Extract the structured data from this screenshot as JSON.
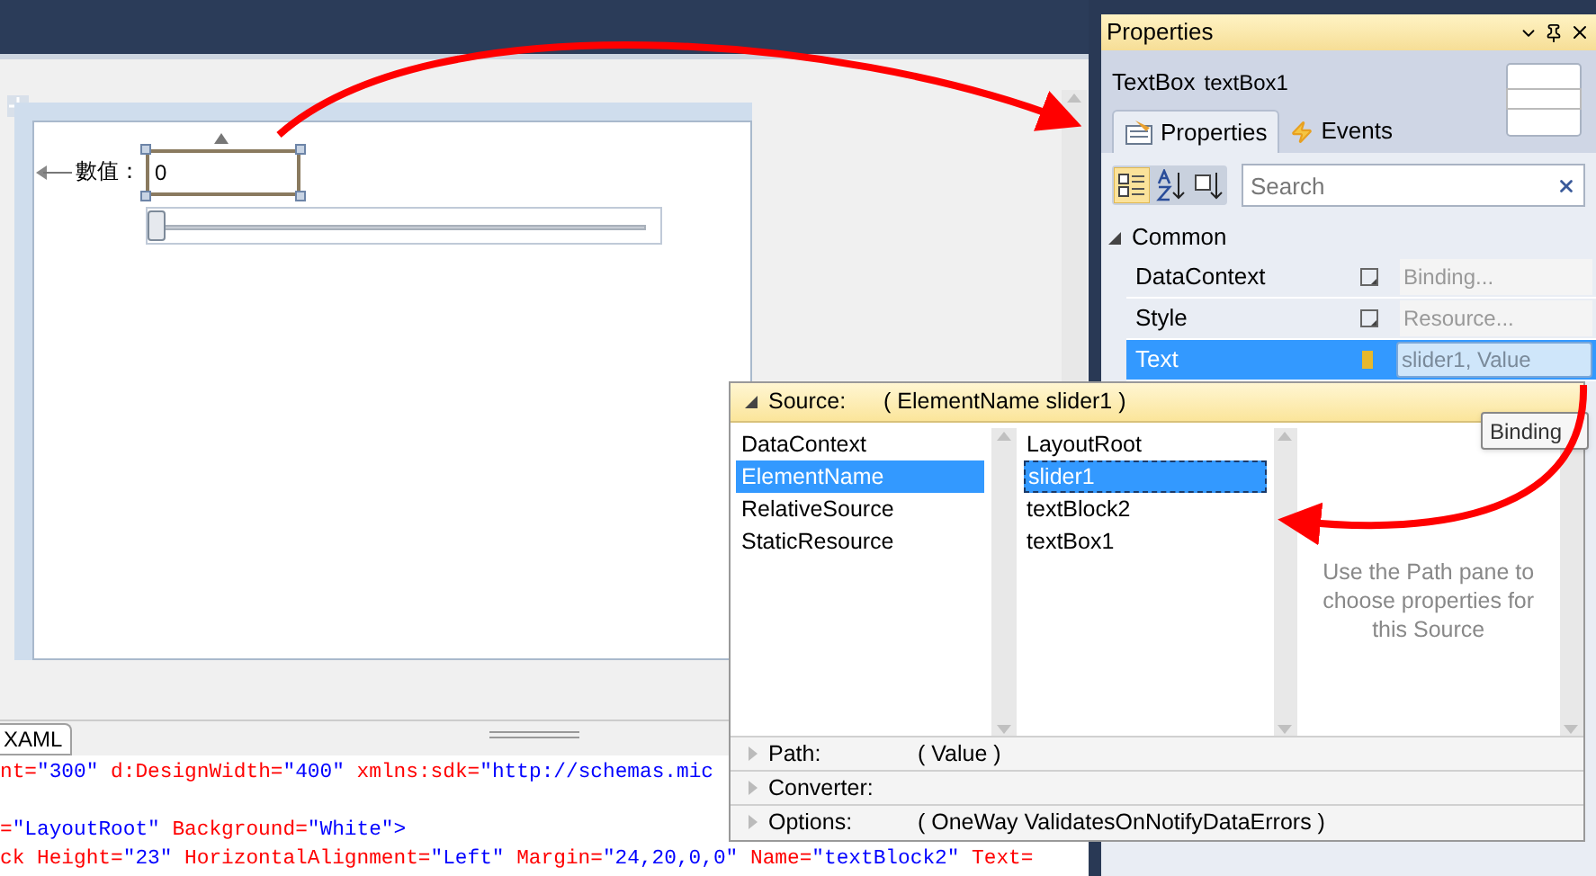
{
  "designer": {
    "label": "數值：",
    "textbox_value": "0",
    "slider": {
      "level": 0
    }
  },
  "editor": {
    "tab": "XAML",
    "lines": [
      [
        {
          "kind": "attr",
          "text": "nt="
        },
        {
          "kind": "value",
          "text": "\"300\""
        },
        {
          "kind": "attr",
          "text": " d:DesignWidth="
        },
        {
          "kind": "value",
          "text": "\"400\""
        },
        {
          "kind": "attr",
          "text": " xmlns:sdk="
        },
        {
          "kind": "value",
          "text": "\"http://schemas.mic"
        }
      ],
      [
        {
          "kind": "attr",
          "text": "="
        },
        {
          "kind": "value",
          "text": "\"LayoutRoot\""
        },
        {
          "kind": "attr",
          "text": " Background="
        },
        {
          "kind": "value",
          "text": "\"White\">"
        }
      ],
      [
        {
          "kind": "attr",
          "text": "ck Height="
        },
        {
          "kind": "value",
          "text": "\"23\""
        },
        {
          "kind": "attr",
          "text": " HorizontalAlignment="
        },
        {
          "kind": "value",
          "text": "\"Left\""
        },
        {
          "kind": "attr",
          "text": " Margin="
        },
        {
          "kind": "value",
          "text": "\"24,20,0,0\""
        },
        {
          "kind": "attr",
          "text": " Name="
        },
        {
          "kind": "value",
          "text": "\"textBlock2\""
        },
        {
          "kind": "attr",
          "text": " Text="
        }
      ]
    ]
  },
  "properties": {
    "title": "Properties",
    "type": "TextBox",
    "name": "textBox1",
    "tabs": [
      {
        "label": "Properties",
        "selected": true
      },
      {
        "label": "Events",
        "selected": false
      }
    ],
    "search": {
      "placeholder": "Search"
    },
    "category": "Common",
    "rows": [
      {
        "name": "DataContext",
        "value": "Binding...",
        "selected": false
      },
      {
        "name": "Style",
        "value": "Resource...",
        "selected": false
      },
      {
        "name": "Text",
        "value": "slider1, Value",
        "selected": true
      }
    ]
  },
  "tooltip": "Binding",
  "binding_popup": {
    "source_label": "Source:",
    "source_value": "( ElementName slider1 )",
    "source_types": [
      {
        "label": "DataContext",
        "selected": false
      },
      {
        "label": "ElementName",
        "selected": true
      },
      {
        "label": "RelativeSource",
        "selected": false
      },
      {
        "label": "StaticResource",
        "selected": false
      }
    ],
    "elements": [
      {
        "label": "LayoutRoot",
        "selected": false
      },
      {
        "label": "slider1",
        "selected": true
      },
      {
        "label": "textBlock2",
        "selected": false
      },
      {
        "label": "textBox1",
        "selected": false
      }
    ],
    "hint": "Use the Path pane to choose properties for this Source",
    "sections": [
      {
        "label": "Path:",
        "value": "( Value )"
      },
      {
        "label": "Converter:"
      },
      {
        "label": "Options:",
        "value": "( OneWay ValidatesOnNotifyDataErrors )"
      }
    ]
  }
}
